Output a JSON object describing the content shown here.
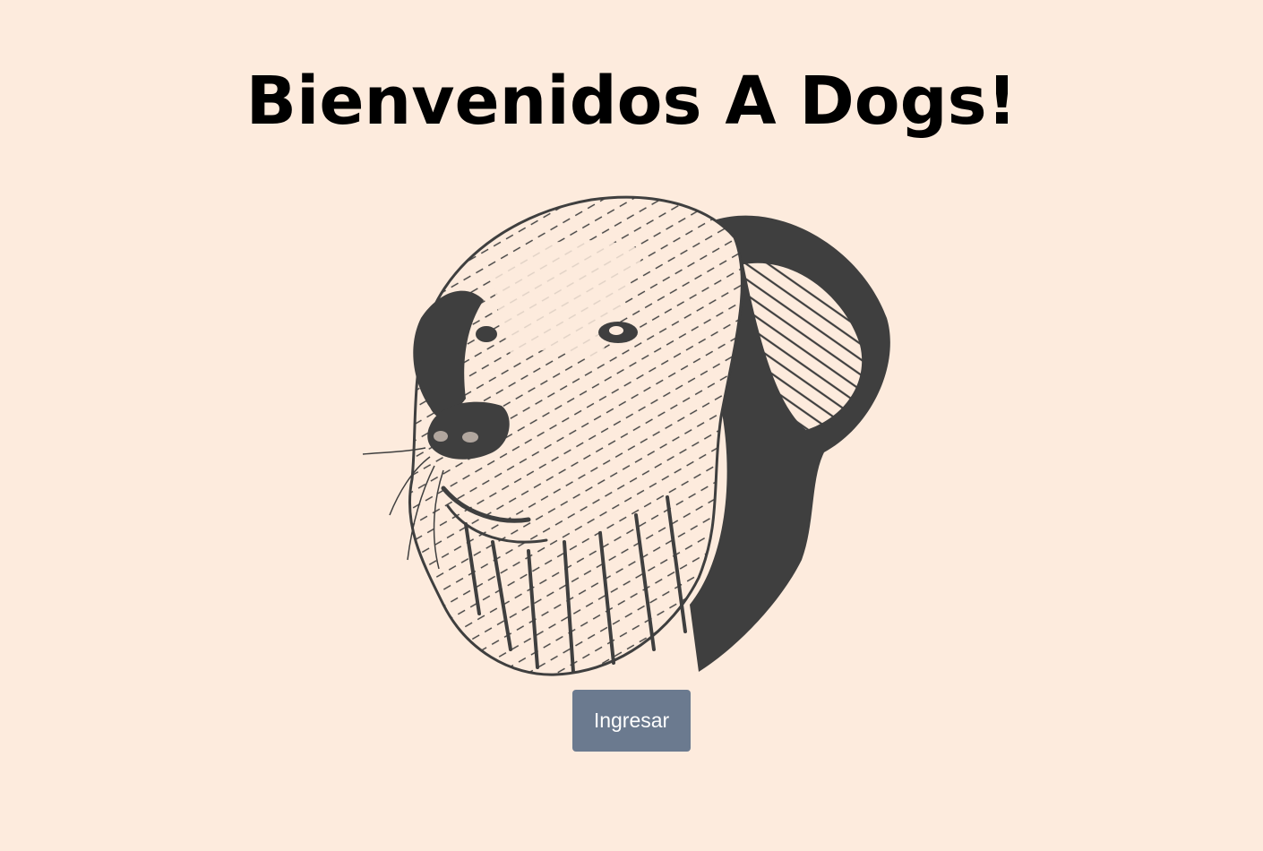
{
  "page": {
    "title": "Bienvenidos A Dogs!",
    "background_color": "#fdebdd",
    "title_color": "#000000"
  },
  "hero": {
    "icon": "dog-head-illustration",
    "ink_color": "#3f3f3f"
  },
  "actions": {
    "enter_label": "Ingresar",
    "enter_color": "#6b7a8f"
  }
}
